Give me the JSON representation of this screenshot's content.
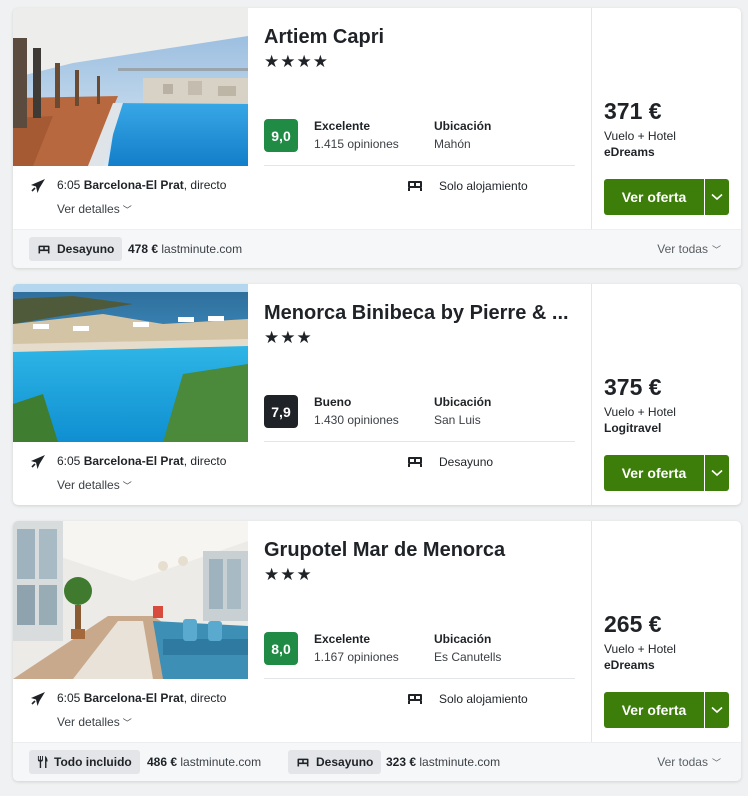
{
  "colors": {
    "score_excellent": "#208b44",
    "score_good": "#1f2327",
    "offer_button": "#3d7d0a"
  },
  "hotels": [
    {
      "name": "Artiem Capri",
      "stars": "★★★★",
      "score": "9,0",
      "rating_label": "Excelente",
      "reviews": "1.415 opiniones",
      "location_label": "Ubicación",
      "location": "Mahón",
      "flight_time": "6:05",
      "flight_airport": "Barcelona-El Prat",
      "flight_type": ", directo",
      "details_label": "Ver detalles",
      "board": "Solo alojamiento",
      "price": "371 €",
      "package": "Vuelo + Hotel",
      "provider": "eDreams",
      "offer_label": "Ver oferta",
      "alt_offers": [
        {
          "tag": "Desayuno",
          "price": "478 €",
          "site": "lastminute.com"
        }
      ],
      "see_all": "Ver todas"
    },
    {
      "name": "Menorca Binibeca by Pierre & ...",
      "stars": "★★★",
      "score": "7,9",
      "rating_label": "Bueno",
      "reviews": "1.430 opiniones",
      "location_label": "Ubicación",
      "location": "San Luis",
      "flight_time": "6:05",
      "flight_airport": "Barcelona-El Prat",
      "flight_type": ", directo",
      "details_label": "Ver detalles",
      "board": "Desayuno",
      "price": "375 €",
      "package": "Vuelo + Hotel",
      "provider": "Logitravel",
      "offer_label": "Ver oferta"
    },
    {
      "name": "Grupotel Mar de Menorca",
      "stars": "★★★",
      "score": "8,0",
      "rating_label": "Excelente",
      "reviews": "1.167 opiniones",
      "location_label": "Ubicación",
      "location": "Es Canutells",
      "flight_time": "6:05",
      "flight_airport": "Barcelona-El Prat",
      "flight_type": ", directo",
      "details_label": "Ver detalles",
      "board": "Solo alojamiento",
      "price": "265 €",
      "package": "Vuelo + Hotel",
      "provider": "eDreams",
      "offer_label": "Ver oferta",
      "alt_offers": [
        {
          "tag": "Todo incluido",
          "price": "486 €",
          "site": "lastminute.com"
        },
        {
          "tag": "Desayuno",
          "price": "323 €",
          "site": "lastminute.com"
        }
      ],
      "see_all": "Ver todas"
    }
  ]
}
